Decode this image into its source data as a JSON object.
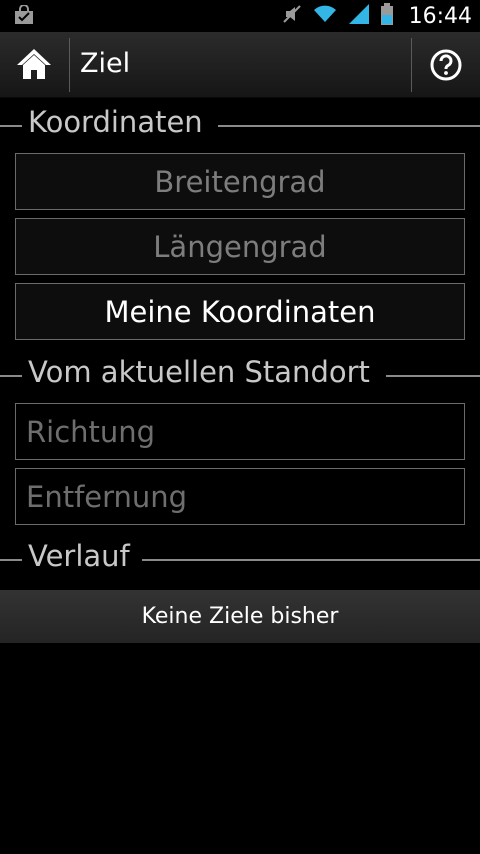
{
  "status_bar": {
    "time": "16:44",
    "icons": [
      "shopping-bag-icon",
      "mute-icon",
      "wifi-icon",
      "signal-icon",
      "battery-icon"
    ]
  },
  "action_bar": {
    "title": "Ziel",
    "home_icon": "home-icon",
    "help_icon": "help-icon"
  },
  "sections": {
    "coordinates": {
      "header": "Koordinaten",
      "latitude_placeholder": "Breitengrad",
      "longitude_placeholder": "Längengrad",
      "my_coordinates_button": "Meine Koordinaten"
    },
    "from_current_location": {
      "header": "Vom aktuellen Standort",
      "direction_placeholder": "Richtung",
      "distance_placeholder": "Entfernung"
    },
    "history": {
      "header": "Verlauf",
      "empty_text": "Keine Ziele bisher"
    }
  },
  "colors": {
    "background": "#000000",
    "divider": "#8a8a8a",
    "field_border": "#6a6a6a",
    "placeholder_text": "#7d7d7d"
  }
}
